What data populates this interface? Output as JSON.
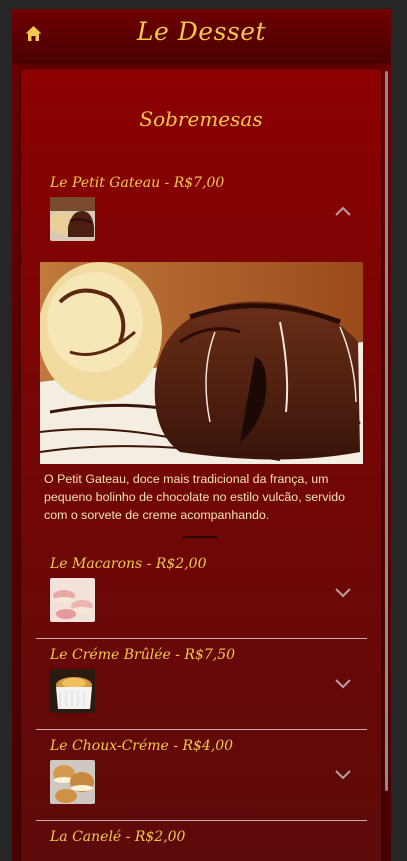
{
  "app": {
    "title": "Le Desset"
  },
  "menu": {
    "section_title": "Sobremesas",
    "items": [
      {
        "title": "Le Petit Gateau - R$7,00",
        "expanded": true,
        "description": "O Petit Gateau, doce mais tradicional da frança, um pequeno bolinho de chocolate no estilo vulcão, servido com o sorvete de creme acompanhando."
      },
      {
        "title": "Le Macarons - R$2,00",
        "expanded": false
      },
      {
        "title": "Le Créme Brûlée - R$7,50",
        "expanded": false
      },
      {
        "title": "Le Choux-Créme - R$4,00",
        "expanded": false
      },
      {
        "title": "La Canelé - R$2,00",
        "expanded": false
      }
    ]
  },
  "icons": {
    "home": "home-icon",
    "expand": "chevron-down-icon",
    "collapse": "chevron-up-icon"
  },
  "colors": {
    "accent_gold": "#f2c94c",
    "background_dark": "#262626",
    "card_red": "#8c0000"
  }
}
